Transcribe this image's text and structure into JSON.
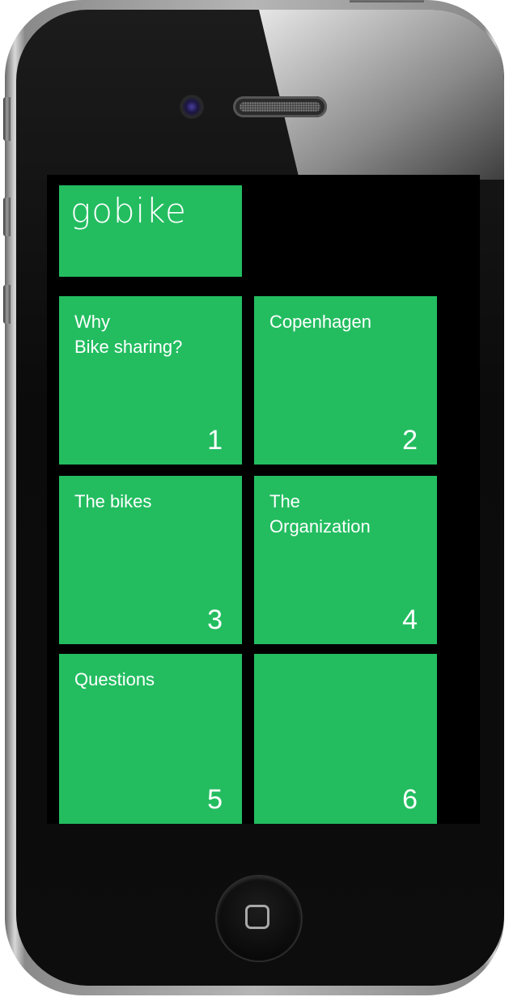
{
  "app": {
    "title": "gobike"
  },
  "tiles": [
    {
      "label": "Why\nBike sharing?",
      "number": "1"
    },
    {
      "label": "Copenhagen",
      "number": "2"
    },
    {
      "label": "The bikes",
      "number": "3"
    },
    {
      "label": "The\nOrganization",
      "number": "4"
    },
    {
      "label": "Questions",
      "number": "5"
    },
    {
      "label": "",
      "number": "6"
    }
  ],
  "device": {
    "home_button_icon": "home-square-icon"
  },
  "colors": {
    "tile_green": "#23bd60",
    "screen_background": "#000000",
    "tile_text": "#ffffff"
  }
}
